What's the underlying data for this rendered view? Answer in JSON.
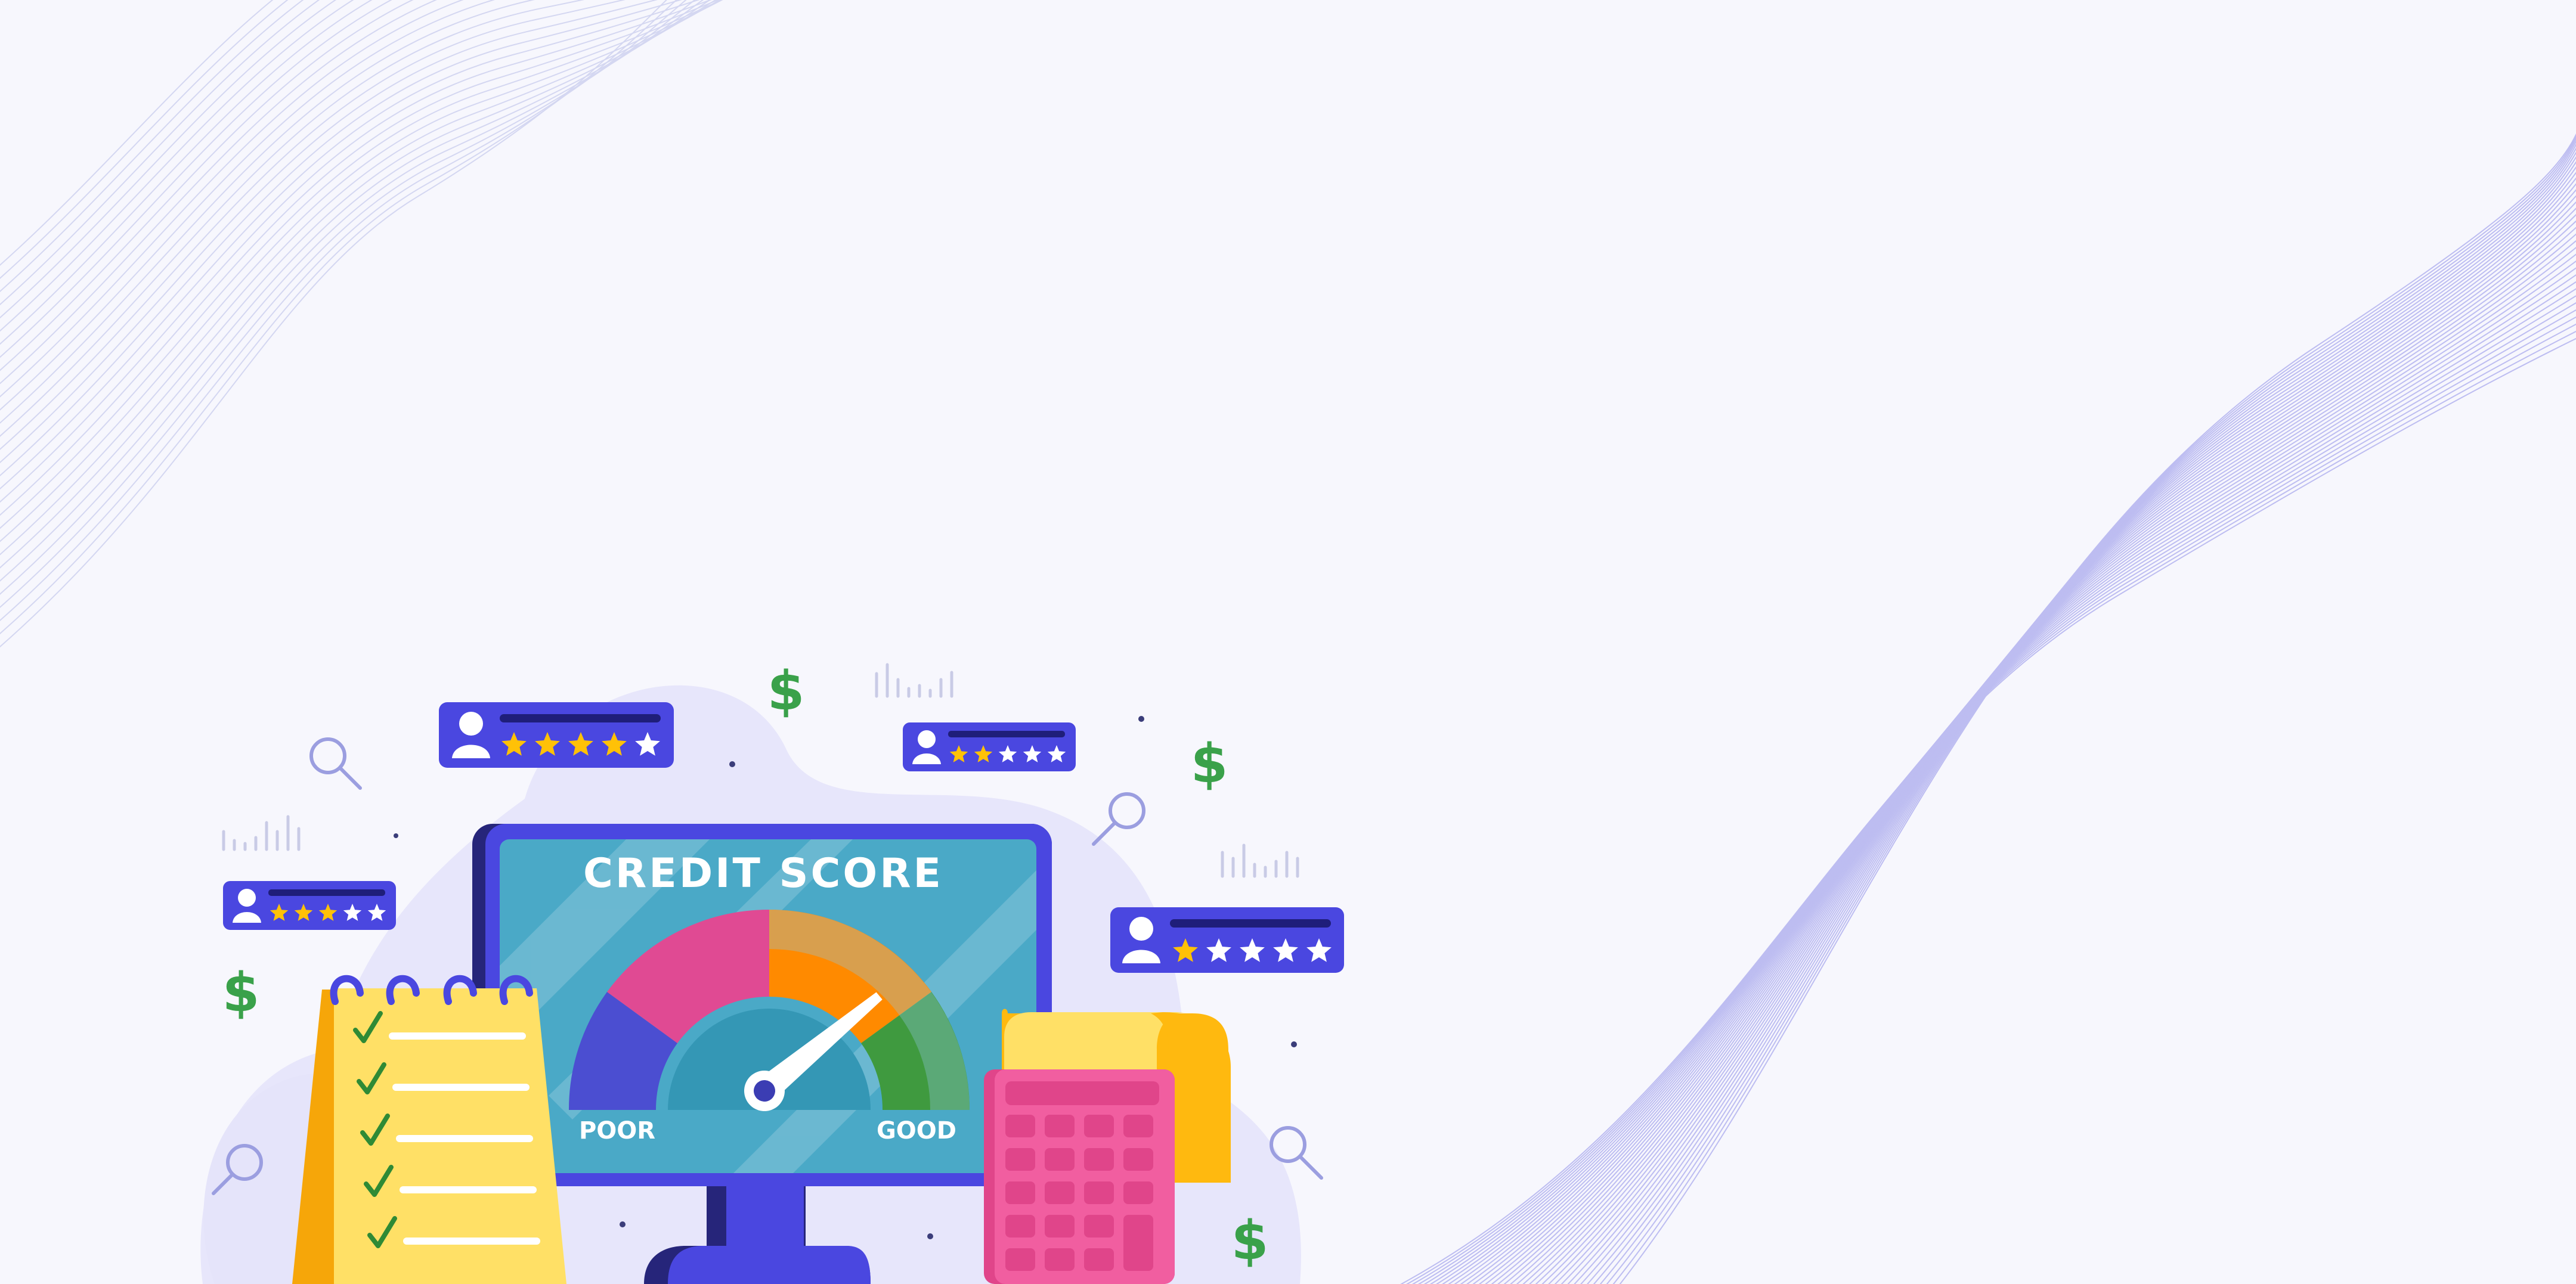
{
  "screen": {
    "title": "CREDIT SCORE",
    "gauge_low_label": "POOR",
    "gauge_high_label": "GOOD",
    "gauge_needle_level": 0.78
  },
  "review_cards": [
    {
      "rating": 4,
      "max": 5
    },
    {
      "rating": 2,
      "max": 5
    },
    {
      "rating": 3,
      "max": 5
    },
    {
      "rating": 1,
      "max": 5
    }
  ],
  "currency_symbol": "$",
  "colors": {
    "background": "#f7f7fd",
    "primary_blue": "#4a47e0",
    "screen_teal": "#4aa9c7",
    "money_green": "#3aa14a",
    "gauge_blue": "#4b4ed1",
    "gauge_pink": "#e04a93",
    "gauge_orange": "#ff8a00",
    "gauge_green": "#3f9a3f",
    "notepad_yellow": "#ffe066",
    "calculator_pink": "#f15ea0"
  },
  "icons": [
    "user-icon",
    "star-icon",
    "magnifier-icon",
    "dollar-icon",
    "checkmark-icon",
    "calculator-icon",
    "notepad-icon",
    "monitor-icon"
  ]
}
